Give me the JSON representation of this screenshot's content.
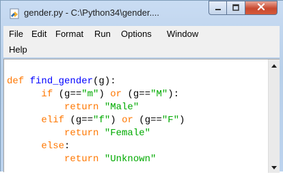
{
  "window": {
    "title": "gender.py - C:\\Python34\\gender....",
    "icon": "python-file-icon"
  },
  "caption_buttons": [
    "minimize-icon",
    "maximize-icon",
    "close-icon"
  ],
  "menu": [
    "File",
    "Edit",
    "Format",
    "Run",
    "Options",
    "Window",
    "Help"
  ],
  "code": {
    "line1": {
      "kw": "def ",
      "fn": "find_gender",
      "rest": "(g):"
    },
    "line2": {
      "indent": "      ",
      "kw1": "if",
      "p1": " (g==",
      "s1": "\"m\"",
      "p2": ") ",
      "kw2": "or",
      "p3": " (g==",
      "s2": "\"M\"",
      "p4": "):"
    },
    "line3": {
      "indent": "          ",
      "kw": "return ",
      "s": "\"Male\""
    },
    "line4": {
      "indent": "      ",
      "kw1": "elif",
      "p1": " (g==",
      "s1": "\"f\"",
      "p2": ") ",
      "kw2": "or",
      "p3": " (g==",
      "s2": "\"F\"",
      "p4": ")"
    },
    "line5": {
      "indent": "          ",
      "kw": "return ",
      "s": "\"Female\""
    },
    "line6": {
      "indent": "      ",
      "kw": "else",
      "rest": ":"
    },
    "line7": {
      "indent": "          ",
      "kw": "return ",
      "s": "\"Unknown\""
    }
  },
  "colors": {
    "keyword": "#ff7700",
    "string": "#00aa00",
    "definition": "#0000ff"
  }
}
